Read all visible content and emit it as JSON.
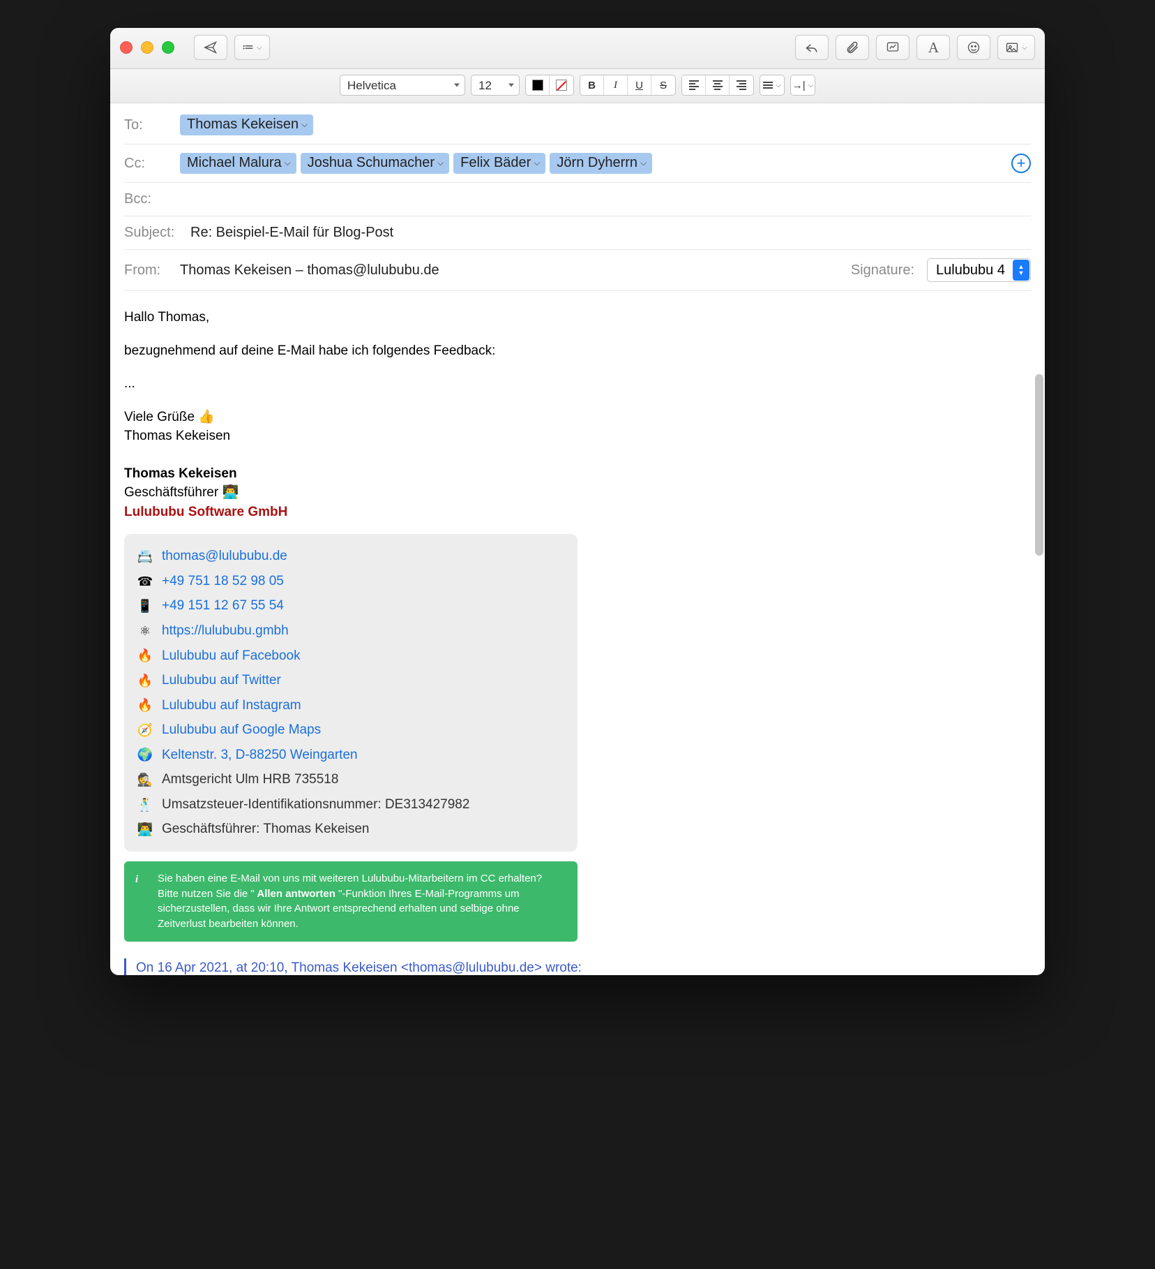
{
  "toolbar": {
    "font_family": "Helvetica",
    "font_size": "12"
  },
  "headers": {
    "to_label": "To:",
    "cc_label": "Cc:",
    "bcc_label": "Bcc:",
    "subject_label": "Subject:",
    "from_label": "From:",
    "signature_label": "Signature:",
    "to": [
      "Thomas Kekeisen"
    ],
    "cc": [
      "Michael Malura",
      "Joshua Schumacher",
      "Felix Bäder",
      "Jörn Dyherrn"
    ],
    "subject": "Re: Beispiel-E-Mail für Blog-Post",
    "from": "Thomas Kekeisen – thomas@lulububu.de",
    "signature_selected": "Lulububu 4"
  },
  "body": {
    "greeting": "Hallo Thomas,",
    "line1": "bezugnehmend auf deine E-Mail habe ich folgendes Feedback:",
    "ellipsis": "...",
    "closing": "Viele Grüße 👍",
    "closing_name": "Thomas Kekeisen"
  },
  "signature": {
    "name": "Thomas Kekeisen",
    "title": "Geschäftsführer 👨‍💻",
    "company": "Lulububu Software GmbH",
    "contacts": [
      {
        "icon": "📇",
        "text": "thomas@lulububu.de",
        "link": true
      },
      {
        "icon": "☎",
        "text": "+49 751 18 52 98 05",
        "link": true
      },
      {
        "icon": "📱",
        "text": "+49 151 12 67 55 54",
        "link": true
      },
      {
        "icon": "⚛",
        "text": "https://lulububu.gmbh",
        "link": true
      },
      {
        "icon": "🔥",
        "text": "Lulububu auf Facebook",
        "link": true
      },
      {
        "icon": "🔥",
        "text": "Lulububu auf Twitter",
        "link": true
      },
      {
        "icon": "🔥",
        "text": "Lulububu auf Instagram",
        "link": true
      },
      {
        "icon": "🧭",
        "text": "Lulububu auf Google Maps",
        "link": true
      },
      {
        "icon": "🌍",
        "text": "Keltenstr. 3, D-88250 Weingarten",
        "link": true
      },
      {
        "icon": "🕵️",
        "text": "Amtsgericht Ulm HRB 735518",
        "link": false
      },
      {
        "icon": "🕺",
        "text": "Umsatzsteuer-Identifikationsnummer: DE313427982",
        "link": false
      },
      {
        "icon": "👨‍💻",
        "text": "Geschäftsführer: Thomas Kekeisen",
        "link": false
      }
    ]
  },
  "notice": {
    "pre": "Sie haben eine E-Mail von uns mit weiteren Lulububu-Mitarbeitern im CC erhalten? Bitte nutzen Sie die \"",
    "bold": " Allen antworten ",
    "post": "\"-Funktion Ihres E-Mail-Programms um sicherzustellen, dass wir Ihre Antwort entsprechend erhalten und selbige ohne Zeitverlust bearbeiten können."
  },
  "quote": {
    "line": "On 16 Apr 2021, at 20:10, Thomas Kekeisen <thomas@lulububu.de> wrote:"
  }
}
